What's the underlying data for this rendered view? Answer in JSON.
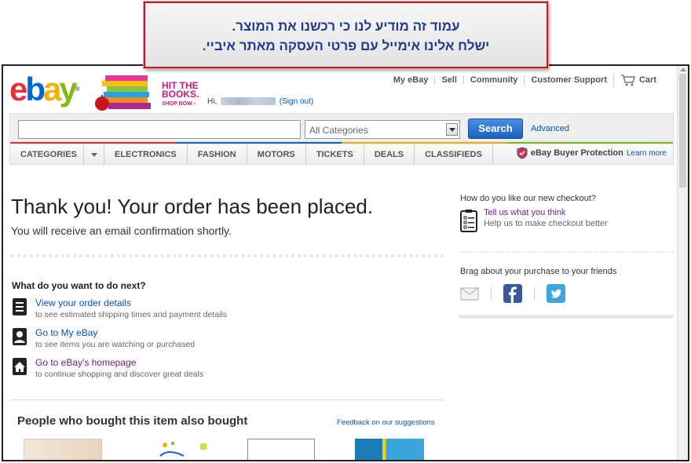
{
  "callout": {
    "line1": "עמוד זה מודיע לנו כי רכשנו את המוצר.",
    "line2": "ישלח אלינו אימייל עם פרטי העסקה מאתר איביי."
  },
  "header": {
    "logo_letters": [
      "e",
      "b",
      "a",
      "y"
    ],
    "logo_reg": "®",
    "promo_line1": "HIT THE",
    "promo_line2": "BOOKS.",
    "promo_shop": "SHOP NOW ›",
    "greeting": "Hi,",
    "sign_out": "(Sign out)",
    "nav": [
      "My eBay",
      "Sell",
      "Community",
      "Customer Support"
    ],
    "cart": "Cart"
  },
  "search": {
    "placeholder": "",
    "category_selected": "All Categories",
    "button": "Search",
    "advanced": "Advanced"
  },
  "categories": {
    "tabs": [
      "CATEGORIES",
      "ELECTRONICS",
      "FASHION",
      "MOTORS",
      "TICKETS",
      "DEALS",
      "CLASSIFIEDS"
    ],
    "protection": "eBay Buyer Protection",
    "learn_more": "Learn more"
  },
  "main": {
    "title": "Thank you! Your order has been placed.",
    "subtitle": "You will receive an email confirmation shortly.",
    "next_question": "What do you want to do next?",
    "actions": [
      {
        "title": "View your order details",
        "sub": "to see estimated shipping times and payment details",
        "icon": "document-icon"
      },
      {
        "title": "Go to My eBay",
        "sub": "to see items you are watching or purchased",
        "icon": "person-icon"
      },
      {
        "title": "Go to eBay's homepage",
        "sub": "to continue shopping and discover great deals",
        "icon": "home-icon"
      }
    ],
    "also_bought": "People who bought this item also bought",
    "feedback": "Feedback on our suggestions"
  },
  "sidebar": {
    "checkout_q": "How do you like our new checkout?",
    "tell_us": "Tell us what you think",
    "help_us": "Help us to make checkout better",
    "brag": "Brag about your purchase to your friends",
    "social_icons": [
      "mail-icon",
      "facebook-icon",
      "twitter-icon"
    ]
  },
  "colors": {
    "ebay_red": "#e53238",
    "ebay_blue": "#0064d2",
    "ebay_yellow": "#f5af02",
    "ebay_green": "#86b817",
    "link": "#0654ba",
    "visited": "#6b1e8f",
    "callout_border": "#b32222",
    "callout_text": "#1f3b91"
  }
}
